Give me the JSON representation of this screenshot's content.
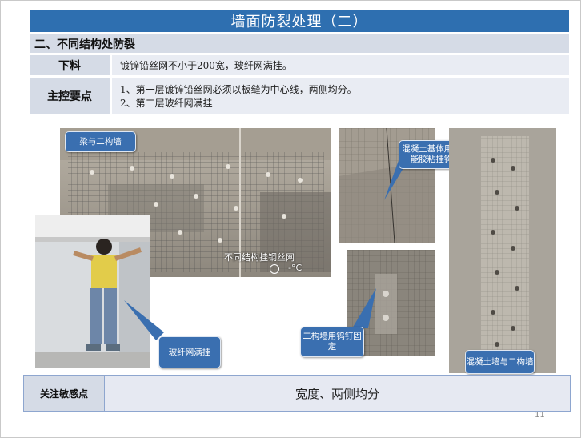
{
  "slide": {
    "title": "墙面防裂处理（二）",
    "section_heading": "二、不同结构处防裂",
    "rows": [
      {
        "label": "下料",
        "lines": [
          "镀锌铅丝网不小于200宽，玻纤网满挂。"
        ]
      },
      {
        "label": "主控要点",
        "lines": [
          "1、第一层镀锌铅丝网必须以板缝为中心线，两侧均分。",
          "2、第二层玻纤网满挂"
        ]
      }
    ],
    "photos": {
      "beam_wall": {
        "callout": "梁与二构墙",
        "caption": "不同结构挂钢丝网",
        "weather_temp": "-°C"
      },
      "worker": {
        "callout": "玻纤网满挂"
      },
      "concrete_base": {
        "callout": "混凝土基体用万能胶粘挂钩"
      },
      "nail_fix": {
        "callout": "二构墙用钨钉固定"
      },
      "tall_wall": {
        "callout": "混凝土墙与二构墙"
      }
    },
    "bottom": {
      "label": "关注敏感点",
      "content": "宽度、两侧均分"
    },
    "page_number": "11"
  },
  "colors": {
    "title_bg": "#2e6fb0",
    "header_bg": "#d5dbe6",
    "content_bg": "#e9ecf3",
    "callout_bg": "#3a6fb0"
  }
}
